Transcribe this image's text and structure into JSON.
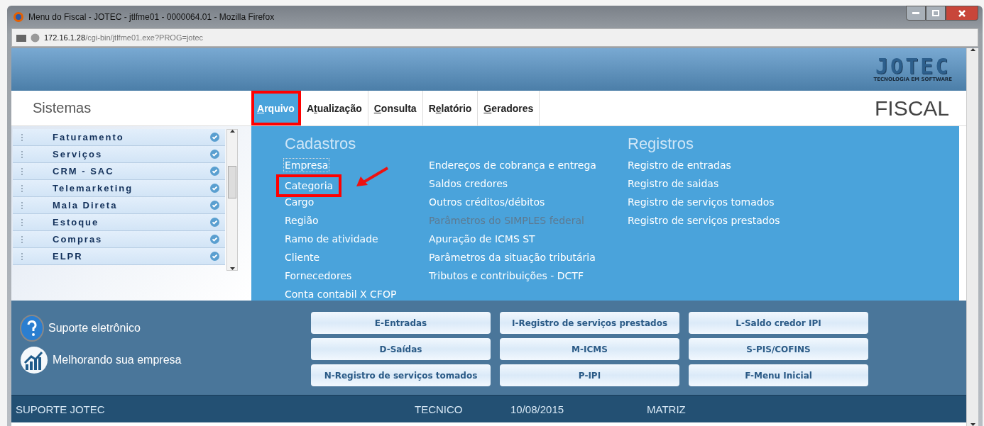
{
  "window": {
    "title": "Menu do Fiscal - JOTEC - jtlfme01 - 0000064.01 - Mozilla Firefox"
  },
  "address_bar": {
    "host": "172.16.1.28",
    "path": "/cgi-bin/jtlfme01.exe?PROG=jotec"
  },
  "logo": {
    "name": "JOTEC",
    "tagline": "TECNOLOGIA EM SOFTWARE"
  },
  "sidebar": {
    "title": "Sistemas",
    "items": [
      {
        "label": "Faturamento"
      },
      {
        "label": "Serviços"
      },
      {
        "label": "CRM - SAC"
      },
      {
        "label": "Telemarketing"
      },
      {
        "label": "Mala Direta"
      },
      {
        "label": "Estoque"
      },
      {
        "label": "Compras"
      },
      {
        "label": "ELPR"
      }
    ]
  },
  "menu_tabs": [
    {
      "key": "A",
      "post": "rquivo",
      "selected": true,
      "highlighted": true
    },
    {
      "pre": "A",
      "key": "t",
      "post": "ualização",
      "selected": false,
      "highlighted": false
    },
    {
      "key": "C",
      "post": "onsulta",
      "selected": false,
      "highlighted": false
    },
    {
      "pre": "R",
      "key": "e",
      "post": "latório",
      "selected": false,
      "highlighted": false
    },
    {
      "key": "G",
      "post": "eradores",
      "selected": false,
      "highlighted": false
    }
  ],
  "module_title": "FISCAL",
  "menu_columns": [
    {
      "heading": "Cadastros",
      "items": [
        {
          "label": "Empresa",
          "focused": true,
          "disabled": false,
          "highlighted": false
        },
        {
          "label": "Categoria",
          "focused": false,
          "disabled": false,
          "highlighted": true
        },
        {
          "label": "Cargo",
          "focused": false,
          "disabled": false,
          "highlighted": false
        },
        {
          "label": "Região",
          "focused": false,
          "disabled": false,
          "highlighted": false
        },
        {
          "label": "Ramo de atividade",
          "focused": false,
          "disabled": false,
          "highlighted": false
        },
        {
          "label": "Cliente",
          "focused": false,
          "disabled": false,
          "highlighted": false
        },
        {
          "label": "Fornecedores",
          "focused": false,
          "disabled": false,
          "highlighted": false
        },
        {
          "label": "Conta contabil X CFOP",
          "focused": false,
          "disabled": false,
          "highlighted": false
        }
      ]
    },
    {
      "items": [
        {
          "label": "Endereços de cobrança e entrega",
          "focused": false,
          "disabled": false,
          "highlighted": false
        },
        {
          "label": "Saldos credores",
          "focused": false,
          "disabled": false,
          "highlighted": false
        },
        {
          "label": "Outros créditos/débitos",
          "focused": false,
          "disabled": false,
          "highlighted": false
        },
        {
          "label": "Parâmetros do SIMPLES federal",
          "focused": false,
          "disabled": true,
          "highlighted": false
        },
        {
          "label": "Apuração de ICMS ST",
          "focused": false,
          "disabled": false,
          "highlighted": false
        },
        {
          "label": "Parâmetros da situação tributária",
          "focused": false,
          "disabled": false,
          "highlighted": false
        },
        {
          "label": "Tributos e contribuições - DCTF",
          "focused": false,
          "disabled": false,
          "highlighted": false
        }
      ]
    },
    {
      "heading": "Registros",
      "items": [
        {
          "label": "Registro de entradas",
          "focused": false,
          "disabled": false,
          "highlighted": false
        },
        {
          "label": "Registro de saidas",
          "focused": false,
          "disabled": false,
          "highlighted": false
        },
        {
          "label": "Registro de serviços tomados",
          "focused": false,
          "disabled": false,
          "highlighted": false
        },
        {
          "label": "Registro de serviços prestados",
          "focused": false,
          "disabled": false,
          "highlighted": false
        }
      ]
    }
  ],
  "support_links": [
    {
      "kind": "help",
      "label": "Suporte eletrônico"
    },
    {
      "kind": "growth",
      "label": "Melhorando sua empresa"
    }
  ],
  "shortcut_buttons": [
    "E-Entradas",
    "I-Registro de serviços prestados",
    "L-Saldo credor IPI",
    "D-Saídas",
    "M-ICMS",
    "S-PIS/COFINS",
    "N-Registro de serviços tomados",
    "P-IPI",
    "F-Menu Inicial"
  ],
  "status_bar": {
    "company": "SUPORTE JOTEC",
    "user": "TECNICO",
    "date": "10/08/2015",
    "branch": "MATRIZ"
  }
}
